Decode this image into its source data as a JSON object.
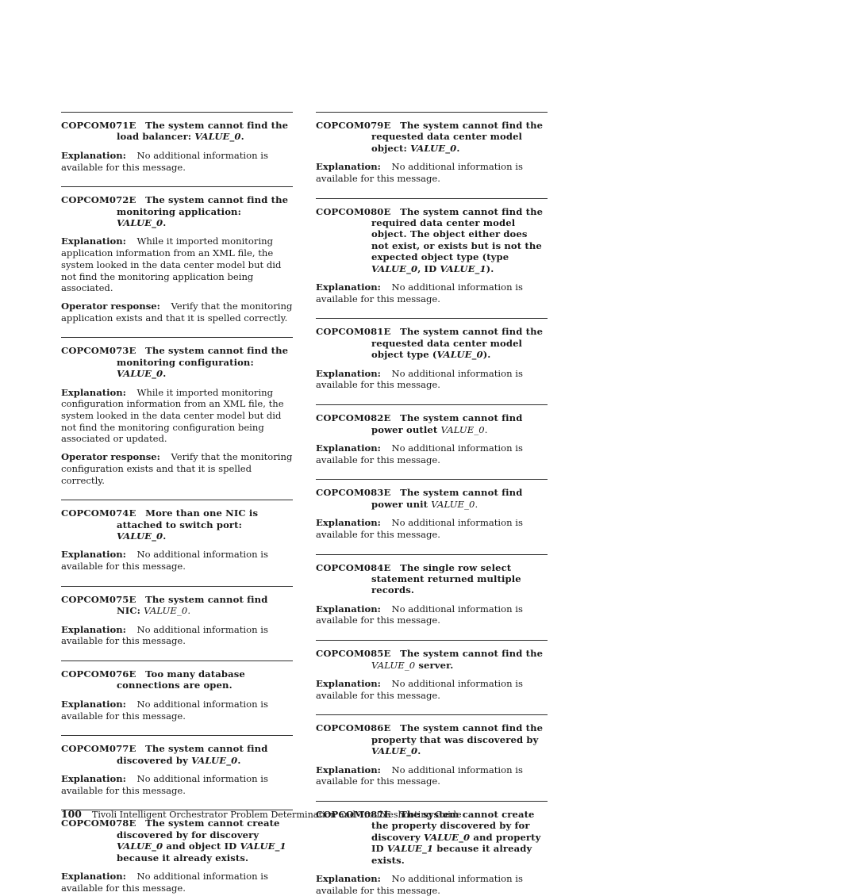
{
  "page": {
    "number": "100",
    "running_title": "Tivoli Intelligent Orchestrator Problem Determination and Troubleshooting Guide",
    "labels": {
      "explanation": "Explanation:",
      "operator_response": "Operator response:"
    }
  },
  "columns": [
    {
      "messages": [
        {
          "id": "COPCOM071E",
          "title_parts": [
            {
              "text": "The system cannot find the load balancer: ",
              "style": "bold"
            },
            {
              "text": "VALUE_0",
              "style": "bold-italic"
            },
            {
              "text": ".",
              "style": "bold"
            }
          ],
          "blocks": [
            {
              "label": "Explanation:",
              "text": "No additional information is available for this message."
            }
          ]
        },
        {
          "id": "COPCOM072E",
          "title_parts": [
            {
              "text": "The system cannot find the monitoring application: ",
              "style": "bold"
            },
            {
              "text": "VALUE_0",
              "style": "bold-italic"
            },
            {
              "text": ".",
              "style": "bold"
            }
          ],
          "blocks": [
            {
              "label": "Explanation:",
              "text": "While it imported monitoring application information from an XML file, the system looked in the data center model but did not find the monitoring application being associated."
            },
            {
              "label": "Operator response:",
              "text": "Verify that the monitoring application exists and that it is spelled correctly."
            }
          ]
        },
        {
          "id": "COPCOM073E",
          "title_parts": [
            {
              "text": "The system cannot find the monitoring configuration: ",
              "style": "bold"
            },
            {
              "text": "VALUE_0",
              "style": "bold-italic"
            },
            {
              "text": ".",
              "style": "bold"
            }
          ],
          "blocks": [
            {
              "label": "Explanation:",
              "text": "While it imported monitoring configuration information from an XML file, the system looked in the data center model but did not find the monitoring configuration being associated or updated."
            },
            {
              "label": "Operator response:",
              "text": "Verify that the monitoring configuration exists and that it is spelled correctly."
            }
          ]
        },
        {
          "id": "COPCOM074E",
          "title_parts": [
            {
              "text": "More than one NIC is attached to switch port: ",
              "style": "bold"
            },
            {
              "text": "VALUE_0",
              "style": "bold-italic"
            },
            {
              "text": ".",
              "style": "bold"
            }
          ],
          "blocks": [
            {
              "label": "Explanation:",
              "text": "No additional information is available for this message."
            }
          ]
        },
        {
          "id": "COPCOM075E",
          "title_parts": [
            {
              "text": "The system cannot find NIC: ",
              "style": "bold"
            },
            {
              "text": "VALUE_0",
              "style": "italic"
            },
            {
              "text": ".",
              "style": "plain"
            }
          ],
          "blocks": [
            {
              "label": "Explanation:",
              "text": "No additional information is available for this message."
            }
          ]
        },
        {
          "id": "COPCOM076E",
          "title_parts": [
            {
              "text": "Too many database connections are open.",
              "style": "bold"
            }
          ],
          "blocks": [
            {
              "label": "Explanation:",
              "text": "No additional information is available for this message."
            }
          ]
        },
        {
          "id": "COPCOM077E",
          "title_parts": [
            {
              "text": "The system cannot find discovered by ",
              "style": "bold"
            },
            {
              "text": "VALUE_0",
              "style": "bold-italic"
            },
            {
              "text": ".",
              "style": "bold"
            }
          ],
          "blocks": [
            {
              "label": "Explanation:",
              "text": "No additional information is available for this message."
            }
          ]
        },
        {
          "id": "COPCOM078E",
          "title_parts": [
            {
              "text": "The system cannot create discovered by for discovery ",
              "style": "bold"
            },
            {
              "text": "VALUE_0",
              "style": "bold-italic"
            },
            {
              "text": " and object ID ",
              "style": "bold"
            },
            {
              "text": "VALUE_1",
              "style": "bold-italic"
            },
            {
              "text": " because it already exists.",
              "style": "bold"
            }
          ],
          "blocks": [
            {
              "label": "Explanation:",
              "text": "No additional information is available for this message."
            }
          ]
        }
      ]
    },
    {
      "messages": [
        {
          "id": "COPCOM079E",
          "title_parts": [
            {
              "text": "The system cannot find the requested data center model object: ",
              "style": "bold"
            },
            {
              "text": "VALUE_0",
              "style": "bold-italic"
            },
            {
              "text": ".",
              "style": "bold"
            }
          ],
          "blocks": [
            {
              "label": "Explanation:",
              "text": "No additional information is available for this message."
            }
          ]
        },
        {
          "id": "COPCOM080E",
          "title_parts": [
            {
              "text": "The system cannot find the required data center model object. The object either does not exist, or exists but is not the expected object type (type ",
              "style": "bold"
            },
            {
              "text": "VALUE_0",
              "style": "bold-italic"
            },
            {
              "text": ", ID ",
              "style": "bold"
            },
            {
              "text": "VALUE_1",
              "style": "bold-italic"
            },
            {
              "text": ").",
              "style": "bold"
            }
          ],
          "blocks": [
            {
              "label": "Explanation:",
              "text": "No additional information is available for this message."
            }
          ]
        },
        {
          "id": "COPCOM081E",
          "title_parts": [
            {
              "text": "The system cannot find the requested data center model object type (",
              "style": "bold"
            },
            {
              "text": "VALUE_0",
              "style": "bold-italic"
            },
            {
              "text": ").",
              "style": "bold"
            }
          ],
          "blocks": [
            {
              "label": "Explanation:",
              "text": "No additional information is available for this message."
            }
          ]
        },
        {
          "id": "COPCOM082E",
          "title_parts": [
            {
              "text": "The system cannot find power outlet ",
              "style": "bold"
            },
            {
              "text": "VALUE_0",
              "style": "italic"
            },
            {
              "text": ".",
              "style": "plain"
            }
          ],
          "blocks": [
            {
              "label": "Explanation:",
              "text": "No additional information is available for this message."
            }
          ]
        },
        {
          "id": "COPCOM083E",
          "title_parts": [
            {
              "text": "The system cannot find power unit ",
              "style": "bold"
            },
            {
              "text": "VALUE_0",
              "style": "italic"
            },
            {
              "text": ".",
              "style": "plain"
            }
          ],
          "blocks": [
            {
              "label": "Explanation:",
              "text": "No additional information is available for this message."
            }
          ]
        },
        {
          "id": "COPCOM084E",
          "title_parts": [
            {
              "text": "The single row select statement returned multiple records.",
              "style": "bold"
            }
          ],
          "blocks": [
            {
              "label": "Explanation:",
              "text": "No additional information is available for this message."
            }
          ]
        },
        {
          "id": "COPCOM085E",
          "title_parts": [
            {
              "text": "The system cannot find the ",
              "style": "bold"
            },
            {
              "text": "VALUE_0",
              "style": "italic"
            },
            {
              "text": " server.",
              "style": "bold"
            }
          ],
          "blocks": [
            {
              "label": "Explanation:",
              "text": "No additional information is available for this message."
            }
          ]
        },
        {
          "id": "COPCOM086E",
          "title_parts": [
            {
              "text": "The system cannot find the property that was discovered by ",
              "style": "bold"
            },
            {
              "text": "VALUE_0",
              "style": "bold-italic"
            },
            {
              "text": ".",
              "style": "bold"
            }
          ],
          "blocks": [
            {
              "label": "Explanation:",
              "text": "No additional information is available for this message."
            }
          ]
        },
        {
          "id": "COPCOM087E",
          "title_parts": [
            {
              "text": "The system cannot create the property discovered by for discovery ",
              "style": "bold"
            },
            {
              "text": "VALUE_0",
              "style": "bold-italic"
            },
            {
              "text": " and property ID ",
              "style": "bold"
            },
            {
              "text": "VALUE_1",
              "style": "bold-italic"
            },
            {
              "text": " because it already exists.",
              "style": "bold"
            }
          ],
          "blocks": [
            {
              "label": "Explanation:",
              "text": "No additional information is available for this message."
            }
          ]
        }
      ]
    }
  ]
}
